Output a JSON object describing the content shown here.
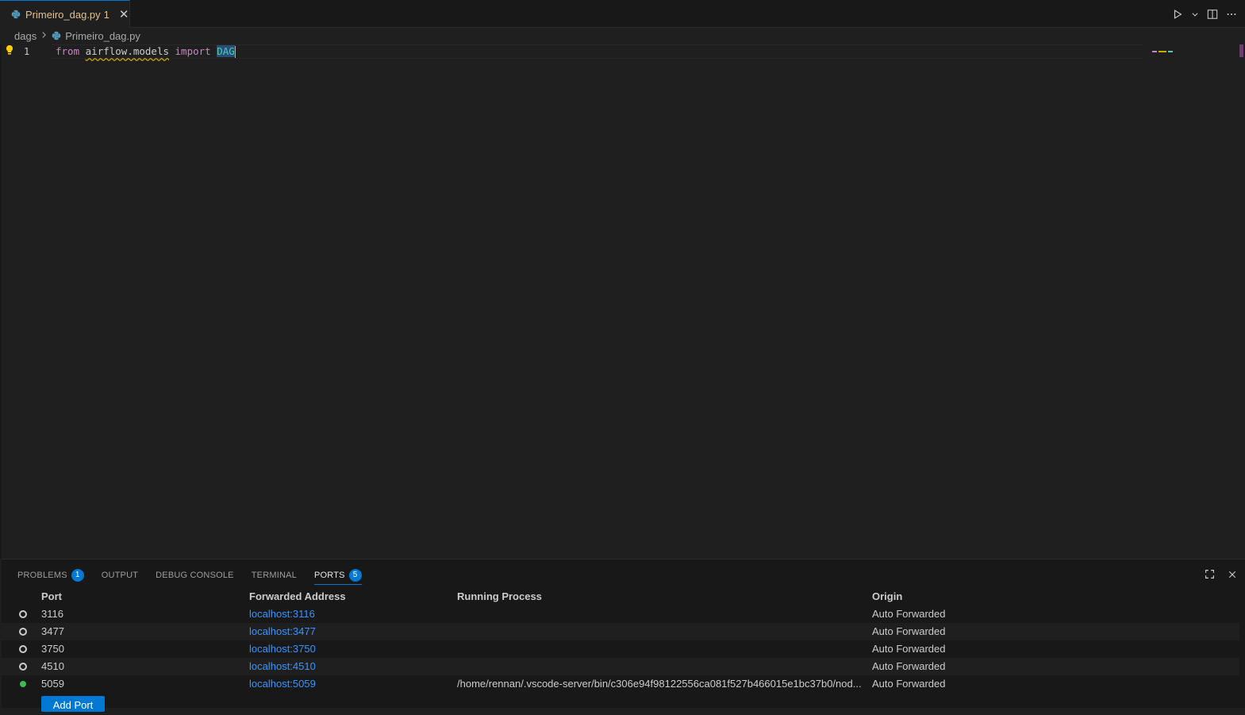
{
  "tab": {
    "label": "Primeiro_dag.py",
    "problem_count": "1",
    "icon": "python-file-icon"
  },
  "breadcrumb": {
    "folder": "dags",
    "file": "Primeiro_dag.py"
  },
  "editor": {
    "line_number": "1",
    "code": {
      "kw_from": "from",
      "module": "airflow.models",
      "kw_import": "import",
      "name": "DAG"
    }
  },
  "panel": {
    "tabs": [
      {
        "label": "PROBLEMS",
        "badge": "1"
      },
      {
        "label": "OUTPUT"
      },
      {
        "label": "DEBUG CONSOLE"
      },
      {
        "label": "TERMINAL"
      },
      {
        "label": "PORTS",
        "badge": "5"
      }
    ],
    "active_tab": "PORTS"
  },
  "ports": {
    "headers": {
      "port": "Port",
      "address": "Forwarded Address",
      "process": "Running Process",
      "origin": "Auto Forwarded"
    },
    "header_origin": "Origin",
    "rows": [
      {
        "status": "inactive",
        "port": "3116",
        "address": "localhost:3116",
        "process": "",
        "origin": "Auto Forwarded"
      },
      {
        "status": "inactive",
        "port": "3477",
        "address": "localhost:3477",
        "process": "",
        "origin": "Auto Forwarded"
      },
      {
        "status": "inactive",
        "port": "3750",
        "address": "localhost:3750",
        "process": "",
        "origin": "Auto Forwarded"
      },
      {
        "status": "inactive",
        "port": "4510",
        "address": "localhost:4510",
        "process": "",
        "origin": "Auto Forwarded"
      },
      {
        "status": "active",
        "port": "5059",
        "address": "localhost:5059",
        "process": "/home/rennan/.vscode-server/bin/c306e94f98122556ca081f527b466015e1bc37b0/nod...",
        "origin": "Auto Forwarded"
      }
    ],
    "add_button": "Add Port"
  },
  "colors": {
    "accent": "#0078d4",
    "modified": "#e2c08d",
    "link": "#3794ff",
    "active_dot": "#3fb950"
  }
}
